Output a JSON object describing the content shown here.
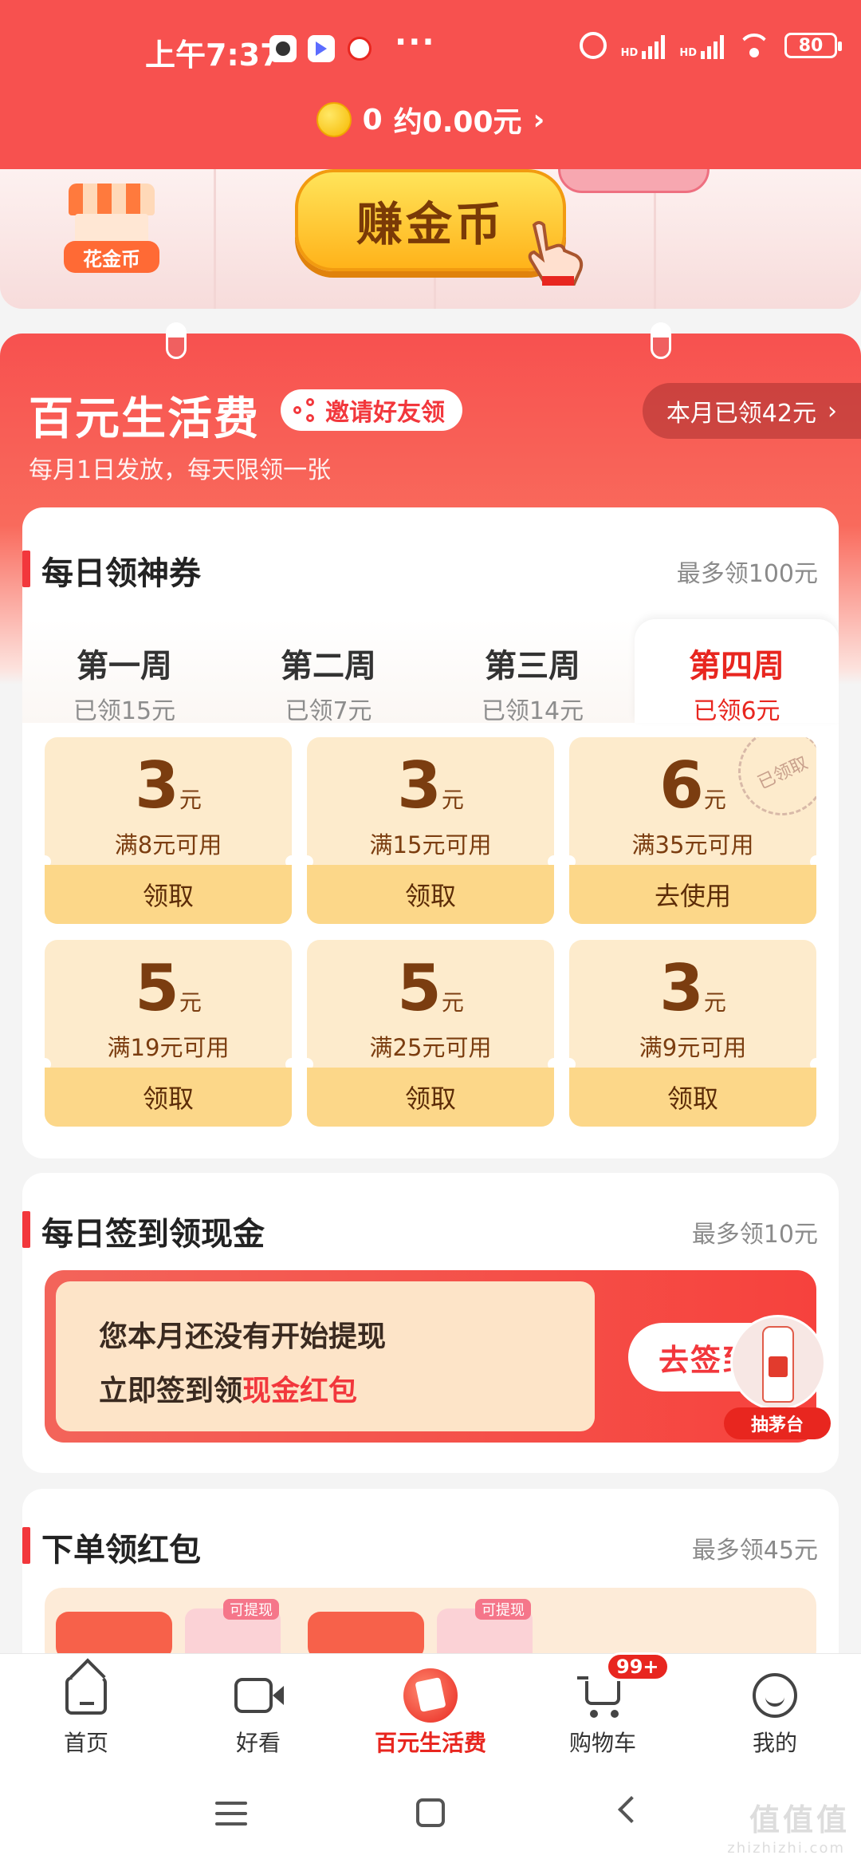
{
  "status_bar": {
    "time": "上午7:37",
    "more": "···",
    "hd1": "HD",
    "hd2": "HD",
    "battery": "80"
  },
  "coin_bar": {
    "coins": "0",
    "amount_text": "约0.00元",
    "chevron": "›"
  },
  "banner": {
    "spend_coins_label": "花金币",
    "earn_coins_button": "赚金币"
  },
  "living_fee": {
    "title": "百元生活费",
    "invite_label": "邀请好友领",
    "month_claimed": "本月已领42元",
    "month_chevron": "›",
    "subtitle": "每月1日发放，每天限领一张"
  },
  "daily_coupons": {
    "title": "每日领神券",
    "max_label": "最多领100元",
    "weeks": [
      {
        "name": "第一周",
        "sub": "已领15元",
        "active": false
      },
      {
        "name": "第二周",
        "sub": "已领7元",
        "active": false
      },
      {
        "name": "第三周",
        "sub": "已领14元",
        "active": false
      },
      {
        "name": "第四周",
        "sub": "已领6元",
        "active": true
      }
    ],
    "coupons": [
      {
        "amount": "3",
        "unit": "元",
        "condition": "满8元可用",
        "action": "领取",
        "claimed": false
      },
      {
        "amount": "3",
        "unit": "元",
        "condition": "满15元可用",
        "action": "领取",
        "claimed": false
      },
      {
        "amount": "6",
        "unit": "元",
        "condition": "满35元可用",
        "action": "去使用",
        "claimed": true
      },
      {
        "amount": "5",
        "unit": "元",
        "condition": "满19元可用",
        "action": "领取",
        "claimed": false
      },
      {
        "amount": "5",
        "unit": "元",
        "condition": "满25元可用",
        "action": "领取",
        "claimed": false
      },
      {
        "amount": "3",
        "unit": "元",
        "condition": "满9元可用",
        "action": "领取",
        "claimed": false
      }
    ],
    "claimed_stamp": "已领取"
  },
  "daily_signin": {
    "title": "每日签到领现金",
    "max_label": "最多领10元",
    "line1": "您本月还没有开始提现",
    "line2_prefix": "立即签到领",
    "line2_highlight": "现金红包",
    "button": "去签到",
    "moutai_tag": "抽茅台"
  },
  "order_red_packet": {
    "title": "下单领红包",
    "max_label": "最多领45元",
    "tag1": "可提现",
    "tag2": "可提现"
  },
  "bottom_nav": {
    "items": [
      {
        "label": "首页",
        "icon": "home-icon"
      },
      {
        "label": "好看",
        "icon": "video-icon"
      },
      {
        "label": "百元生活费",
        "icon": "red-envelope-icon"
      },
      {
        "label": "购物车",
        "icon": "cart-icon"
      },
      {
        "label": "我的",
        "icon": "profile-icon"
      }
    ],
    "cart_badge": "99+"
  },
  "watermark": {
    "main": "值值值",
    "sub": "zhizhizhi.com"
  },
  "colors": {
    "header_red": "#f7514f",
    "accent_red": "#e8261f",
    "coupon_bg": "#fdebcc",
    "coupon_action": "#fcd789"
  }
}
